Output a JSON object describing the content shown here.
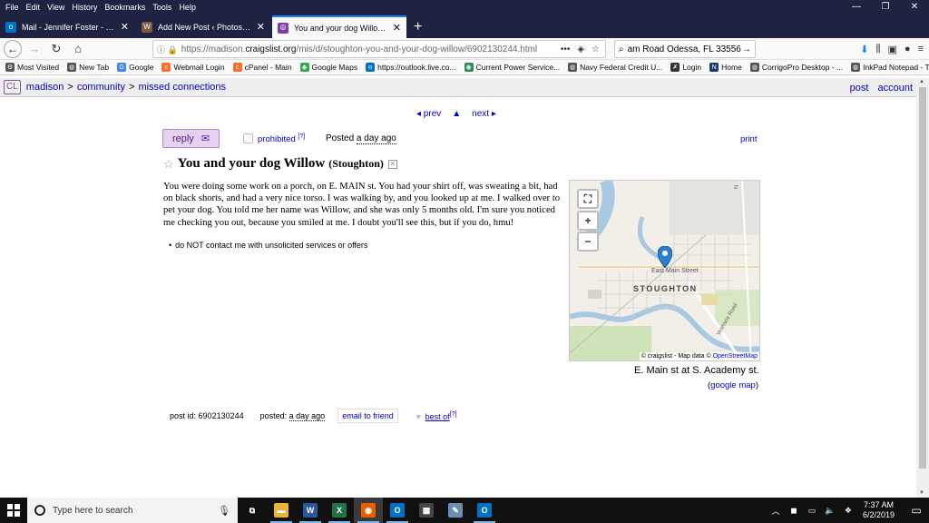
{
  "menubar": {
    "items": [
      "File",
      "Edit",
      "View",
      "History",
      "Bookmarks",
      "Tools",
      "Help"
    ]
  },
  "tabs": [
    {
      "label": "Mail - Jennifer Foster - Outlook",
      "icon": "outlook-icon",
      "color": "#0072c6",
      "glyph": "o"
    },
    {
      "label": "Add New Post ‹ Photos by JFo",
      "icon": "wordpress-icon",
      "color": "#7a5b3a",
      "glyph": "W"
    },
    {
      "label": "You and your dog Willow - mis",
      "icon": "craigslist-peace-icon",
      "color": "#7d3fa5",
      "glyph": "☮"
    }
  ],
  "navbar": {
    "url_prefix": "https://madison.",
    "url_domain": "craigslist.org",
    "url_path": "/mis/d/stoughton-you-and-your-dog-willow/6902130244.html",
    "search_value": "am Road Odessa, FL 33556"
  },
  "bookmarks": [
    {
      "label": "Most Visited",
      "icon": "gear-icon",
      "color": "#555",
      "glyph": "⚙"
    },
    {
      "label": "New Tab",
      "icon": "globe-icon",
      "color": "#555",
      "glyph": "◍"
    },
    {
      "label": "Google",
      "icon": "google-icon",
      "color": "#4285f4",
      "glyph": "G"
    },
    {
      "label": "Webmail Login",
      "icon": "cpanel-icon",
      "color": "#ff6c2c",
      "glyph": "c"
    },
    {
      "label": "cPanel - Main",
      "icon": "cpanel-icon",
      "color": "#ff6c2c",
      "glyph": "c"
    },
    {
      "label": "Google Maps",
      "icon": "maps-icon",
      "color": "#34a853",
      "glyph": "◆"
    },
    {
      "label": "https://outlook.live.co...",
      "icon": "outlook-icon",
      "color": "#0072c6",
      "glyph": "o"
    },
    {
      "label": "Current Power Service...",
      "icon": "power-icon",
      "color": "#2e8b57",
      "glyph": "◉"
    },
    {
      "label": "Navy Federal Credit U...",
      "icon": "globe-icon",
      "color": "#555",
      "glyph": "◍"
    },
    {
      "label": "Login",
      "icon": "login-icon",
      "color": "#333",
      "glyph": "✗"
    },
    {
      "label": "Home",
      "icon": "n-icon",
      "color": "#1a3a6b",
      "glyph": "N"
    },
    {
      "label": "CorrigoPro Desktop - ...",
      "icon": "globe-icon",
      "color": "#555",
      "glyph": "◍"
    },
    {
      "label": "InkPad Notepad - The ...",
      "icon": "globe-icon",
      "color": "#555",
      "glyph": "◍"
    }
  ],
  "cl_header": {
    "logo": "CL",
    "crumbs": [
      "madison",
      "community",
      "missed connections"
    ],
    "sep": ">",
    "post": "post",
    "account": "account"
  },
  "post": {
    "prev": "◂ prev",
    "up": "▲",
    "next": "next ▸",
    "reply": "reply",
    "prohibited": "prohibited",
    "prohibited_sup": "[?]",
    "posted_label": "Posted",
    "posted_value": "a day ago",
    "print": "print",
    "title": "You and your dog Willow",
    "location": "(Stoughton)",
    "body": "You were doing some work on a porch, on E. MAIN st. You had your shirt off, was sweating a bit, had on black shorts, and had a very nice torso. I was walking by, and you looked up at me. I walked over to pet your dog. You told me her name was Willow, and she was only 5 months old. I'm sure you noticed me checking you out, because you smiled at me. I doubt you'll see this, but if you do, hmu!",
    "notice": "do NOT contact me with unsolicited services or offers",
    "map_place": "STOUGHTON",
    "map_street": "East Main Street",
    "map_street2": "Veterans Road",
    "map_street3": "N",
    "map_attrib_prefix": "© craigslist - Map data ©",
    "map_attrib_osm": "OpenStreetMap",
    "map_caption": "E. Main st at S. Academy st.",
    "google_map_open": "(",
    "google_map": "google map",
    "google_map_close": ")",
    "post_id_label": "post id:",
    "post_id": "6902130244",
    "footer_posted_label": "posted:",
    "footer_posted_value": "a day ago",
    "email": "email to friend",
    "best_of": "best of",
    "best_sup": "[?]"
  },
  "taskbar": {
    "search_placeholder": "Type here to search",
    "time": "7:37 AM",
    "date": "6/2/2019",
    "apps": [
      {
        "name": "task-view-icon",
        "color": "#101010",
        "glyph": "⧉",
        "open": false
      },
      {
        "name": "file-explorer-icon",
        "color": "#e8b53a",
        "glyph": "▬",
        "open": true
      },
      {
        "name": "word-icon",
        "color": "#2b579a",
        "glyph": "W",
        "open": true
      },
      {
        "name": "excel-icon",
        "color": "#217346",
        "glyph": "X",
        "open": true
      },
      {
        "name": "firefox-icon",
        "color": "#e66000",
        "glyph": "◉",
        "open": true,
        "active": true
      },
      {
        "name": "outlook-icon",
        "color": "#0072c6",
        "glyph": "O",
        "open": true
      },
      {
        "name": "calculator-icon",
        "color": "#444",
        "glyph": "▦",
        "open": false
      },
      {
        "name": "paint-icon",
        "color": "#6b8fb3",
        "glyph": "✎",
        "open": false
      },
      {
        "name": "outlook-icon",
        "color": "#0072c6",
        "glyph": "O",
        "open": true
      }
    ]
  },
  "colors": {
    "link": "#0000cc",
    "accent": "#7d3fa5",
    "reply_bg": "#e5d2f0"
  }
}
